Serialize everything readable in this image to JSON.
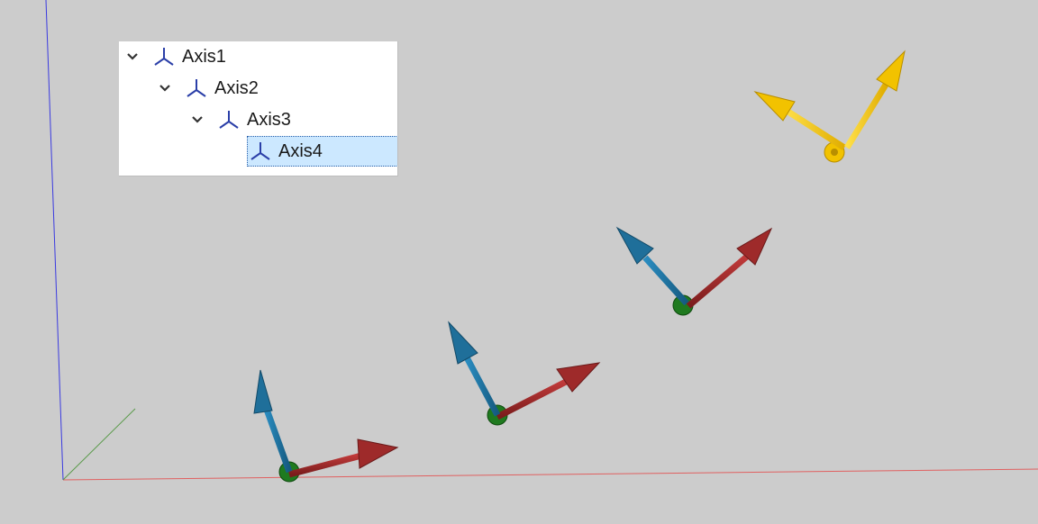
{
  "tree": {
    "items": [
      {
        "label": "Axis1",
        "level": 0,
        "expanded": true,
        "selected": false
      },
      {
        "label": "Axis2",
        "level": 1,
        "expanded": true,
        "selected": false
      },
      {
        "label": "Axis3",
        "level": 2,
        "expanded": true,
        "selected": false
      },
      {
        "label": "Axis4",
        "level": 3,
        "expanded": false,
        "selected": true
      }
    ]
  },
  "colors": {
    "background": "#cccccc",
    "axis_x": "#e06060",
    "axis_y": "#4a8a3a",
    "axis_z": "#3a3ae0",
    "arrow_red": "#9e2a2a",
    "arrow_blue": "#1f6f9a",
    "origin_green": "#1f7a1f",
    "selected_yellow": "#f2c200",
    "tree_icon": "#2b3fa8",
    "tree_selection": "#cce8ff"
  }
}
